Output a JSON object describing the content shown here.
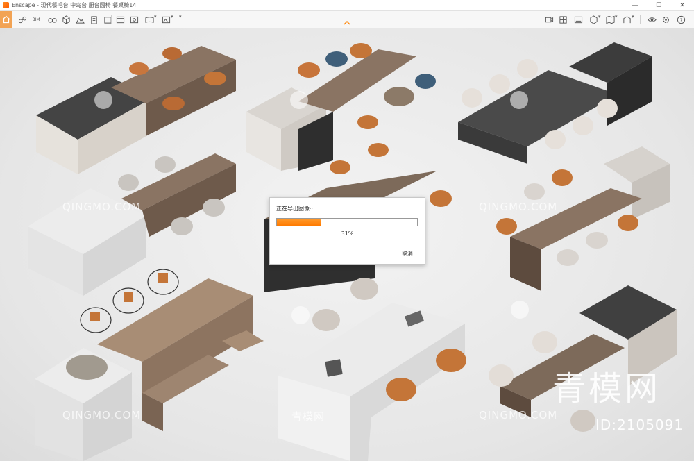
{
  "window": {
    "title": "Enscape - 现代餐吧台 中岛台 厨台圆椅 餐桌椅14",
    "controls": [
      "minimize",
      "maximize",
      "close"
    ]
  },
  "toolbar": {
    "left_icons": [
      "home-icon",
      "link-icon",
      "bim-icon",
      "binoculars-icon",
      "cube-outline-icon",
      "mountain-icon",
      "building-icon",
      "book-icon",
      "window-icon",
      "screenshot-icon",
      "panorama-icon",
      "image-settings-icon",
      "dropdown-icon"
    ],
    "right_icons": [
      "video-icon",
      "grid-icon",
      "cube-icon",
      "scene-icon",
      "feedback-icon",
      "camera-view-icon",
      "box-icon",
      "cloud-icon",
      "map-icon",
      "library-icon",
      "eye-icon",
      "settings-icon",
      "help-icon"
    ],
    "bim_label": "BIM"
  },
  "dialog": {
    "title": "正在导出图像···",
    "progress": 0.31,
    "progress_text": "31%",
    "cancel_label": "取消",
    "fill_color": "#ff8a10"
  },
  "watermark": {
    "small_text": "QINGMO.COM",
    "cn_text": "青模网",
    "brand": "青模网",
    "id": "ID:2105091"
  },
  "colors": {
    "accent": "#ff8a10",
    "home_bg": "#f2a354"
  }
}
